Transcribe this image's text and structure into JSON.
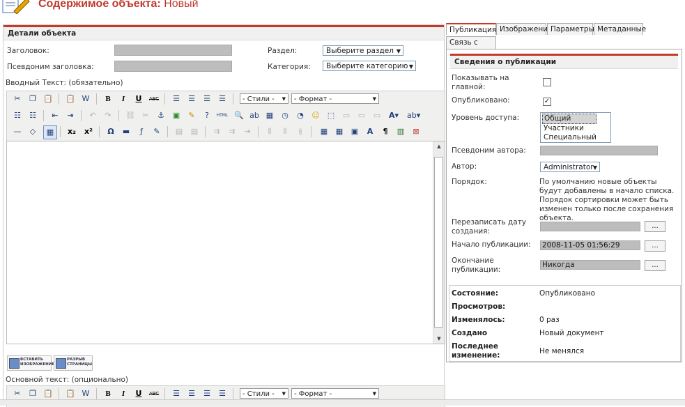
{
  "header": {
    "title_main": "Содержимое объекта:",
    "title_sub": "Новый"
  },
  "details": {
    "section_title": "Детали объекта",
    "title_label": "Заголовок:",
    "alias_label": "Псевдоним заголовка:",
    "section_label": "Раздел:",
    "section_value": "Выберите раздел",
    "category_label": "Категория:",
    "category_value": "Выберите категорию"
  },
  "intro_editor": {
    "label": "Вводный Текст: (обязательно)"
  },
  "main_editor": {
    "label": "Основной текст: (опционально)"
  },
  "toolbar": {
    "styles": "- Стили -",
    "format": "- Формат -"
  },
  "buttons": {
    "insert_image": "ВСТАВИТЬ ИЗОБРАЖЕНИЕ",
    "page_break": "РАЗРЫВ СТРАНИЦЫ"
  },
  "tabs": [
    "Публикация",
    "Изображения",
    "Параметры",
    "Метаданные",
    "Связь с меню"
  ],
  "publication": {
    "section_title": "Сведения о публикации",
    "frontpage_label": "Показывать на главной:",
    "frontpage_checked": false,
    "published_label": "Опубликовано:",
    "published_checked": true,
    "access_label": "Уровень доступа:",
    "access_options": [
      "Общий",
      "Участники",
      "Специальный"
    ],
    "access_selected": "Общий",
    "author_alias_label": "Псевдоним автора:",
    "author_label": "Автор:",
    "author_value": "Administrator",
    "order_label": "Порядок:",
    "order_text": "По умолчанию новые объекты будут добавлены в начало списка. Порядок сортировки может быть изменен только после сохранения объекта.",
    "override_date_label": "Перезаписать дату создания:",
    "publish_start_label": "Начало публикации:",
    "publish_start_value": "2008-11-05 01:56:29",
    "publish_end_label": "Окончание публикации:",
    "publish_end_value": "Никогда",
    "dots": "..."
  },
  "status": {
    "state_label": "Состояние:",
    "state_value": "Опубликовано",
    "views_label": "Просмотров:",
    "views_value": "",
    "changed_label": "Изменялось:",
    "changed_value": "0 раз",
    "created_label": "Создано",
    "created_value": "Новый документ",
    "modified_label": "Последнее изменение:",
    "modified_value": "Не менялся"
  },
  "icons": [
    "cut-icon",
    "copy-icon",
    "paste-icon",
    "paste-text-icon",
    "paste-word-icon",
    "bold-icon",
    "italic-icon",
    "underline-icon",
    "strikethrough-icon",
    "align-left-icon",
    "align-center-icon",
    "align-right-icon",
    "justify-icon",
    "bullet-list-icon",
    "numbered-list-icon",
    "outdent-icon",
    "indent-icon",
    "undo-icon",
    "redo-icon",
    "link-icon",
    "unlink-icon",
    "anchor-icon",
    "image-icon",
    "cleanup-icon",
    "help-icon",
    "html-icon",
    "search-icon",
    "replace-icon",
    "insert-date-icon",
    "insert-time-icon",
    "emoticon-icon",
    "fullscreen-icon",
    "text-color-icon",
    "highlight-icon",
    "hr-icon",
    "eraser-icon",
    "table-icon",
    "subscript-icon",
    "superscript-icon",
    "charmap-icon",
    "flash-icon",
    "edit-icon",
    "film-icon",
    "pilcrow-icon"
  ],
  "colors": {
    "accent": "#c43b2b",
    "input_gray": "#bdbdbd",
    "link_blue": "#1f3f7a"
  }
}
